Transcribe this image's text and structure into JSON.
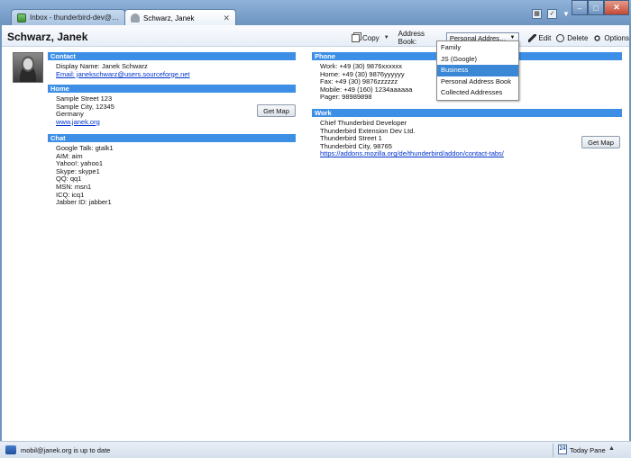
{
  "tabs": [
    {
      "label": "Inbox - thunderbird-dev@ja..."
    },
    {
      "label": "Schwarz, Janek"
    }
  ],
  "header": {
    "title": "Schwarz, Janek",
    "copy_label": "Copy",
    "address_book_label": "Address Book:",
    "address_book_selected": "Personal Address Bo...",
    "edit_label": "Edit",
    "delete_label": "Delete",
    "options_label": "Options"
  },
  "address_book_options": [
    "Family",
    "JS (Google)",
    "Business",
    "Personal Address Book",
    "Collected Addresses"
  ],
  "address_book_highlighted": "Business",
  "sections": {
    "contact": {
      "title": "Contact",
      "display_name": "Display Name: Janek Schwarz",
      "email": "Email: janekschwarz@users.sourceforge.net"
    },
    "home": {
      "title": "Home",
      "lines": [
        "Sample Street 123",
        "Sample City, 12345",
        "Germany"
      ],
      "url": "www.janek.org",
      "map_button": "Get Map"
    },
    "chat": {
      "title": "Chat",
      "lines": [
        "Google Talk: gtalk1",
        "AIM: aim",
        "Yahoo!: yahoo1",
        "Skype: skype1",
        "QQ: qq1",
        "MSN: msn1",
        "ICQ: icq1",
        "Jabber ID: jabber1"
      ]
    },
    "phone": {
      "title": "Phone",
      "lines": [
        "Work: +49 (30) 9876xxxxxx",
        "Home: +49 (30) 9876yyyyyy",
        "Fax: +49 (30) 9876zzzzzz",
        "Mobile: +49 (160) 1234aaaaaa",
        "Pager: 98989898"
      ]
    },
    "work": {
      "title": "Work",
      "lines": [
        "Chief Thunderbird Developer",
        "Thunderbird Extension Dev Ltd.",
        "Thunderbird Street 1",
        "Thunderbird City, 98765"
      ],
      "url": "https://addons.mozilla.org/de/thunderbird/addon/contact-tabs/",
      "map_button": "Get Map"
    }
  },
  "status": {
    "text": "mobil@janek.org is up to date",
    "today_pane": "Today Pane",
    "calendar_day": "24"
  },
  "colors": {
    "section_bar": "#3d8fe6",
    "dropdown_highlight": "#3a87d6",
    "link": "#0033cc"
  }
}
